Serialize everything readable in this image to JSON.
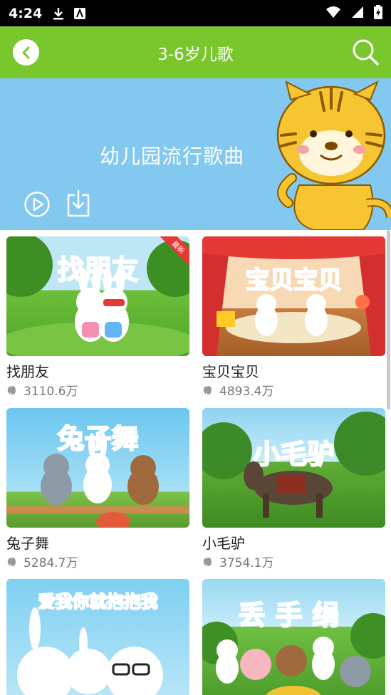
{
  "status": {
    "time": "4:24"
  },
  "header": {
    "title": "3-6岁儿歌"
  },
  "banner": {
    "title": "幼儿园流行歌曲"
  },
  "songs": [
    {
      "title": "找朋友",
      "plays": "3110.6万",
      "thumb_text": "找朋友",
      "badge": "最新"
    },
    {
      "title": "宝贝宝贝",
      "plays": "4893.4万",
      "thumb_text": "宝贝宝贝"
    },
    {
      "title": "兔子舞",
      "plays": "5284.7万",
      "thumb_text": "兔子舞"
    },
    {
      "title": "小毛驴",
      "plays": "3754.1万",
      "thumb_text": "小毛驴"
    },
    {
      "title": "",
      "plays": "",
      "thumb_text": "爱我你就抱抱我"
    },
    {
      "title": "",
      "plays": "",
      "thumb_text": "丢手绢"
    }
  ],
  "colors": {
    "header": "#7ac62d",
    "banner": "#83c8ef"
  }
}
